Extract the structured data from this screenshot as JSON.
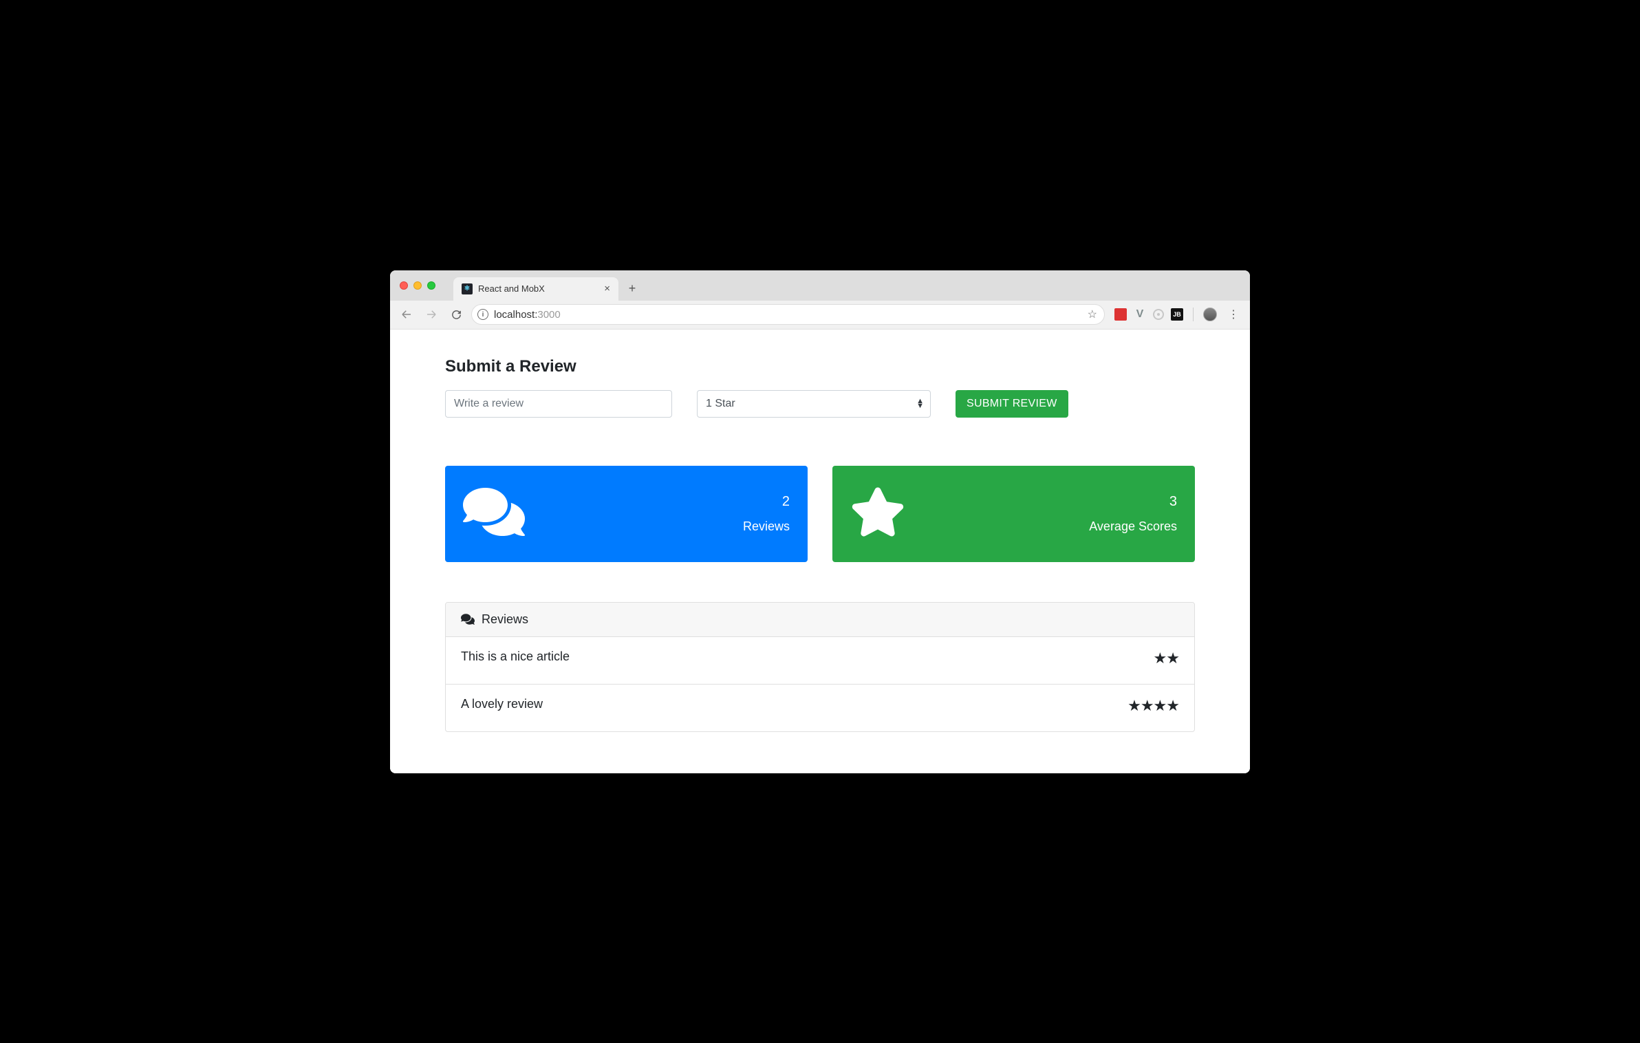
{
  "browser": {
    "tab_title": "React and MobX",
    "url_host": "localhost:",
    "url_port": "3000",
    "ext_jb_label": "JB"
  },
  "page": {
    "heading": "Submit a Review",
    "review_placeholder": "Write a review",
    "star_select_value": "1 Star",
    "submit_label": "SUBMIT REVIEW"
  },
  "stats": {
    "reviews_count": "2",
    "reviews_label": "Reviews",
    "avg_score": "3",
    "avg_label": "Average Scores"
  },
  "panel": {
    "title": "Reviews"
  },
  "reviews": [
    {
      "text": "This is a nice article",
      "stars": "★★"
    },
    {
      "text": "A lovely review",
      "stars": "★★★★"
    }
  ]
}
